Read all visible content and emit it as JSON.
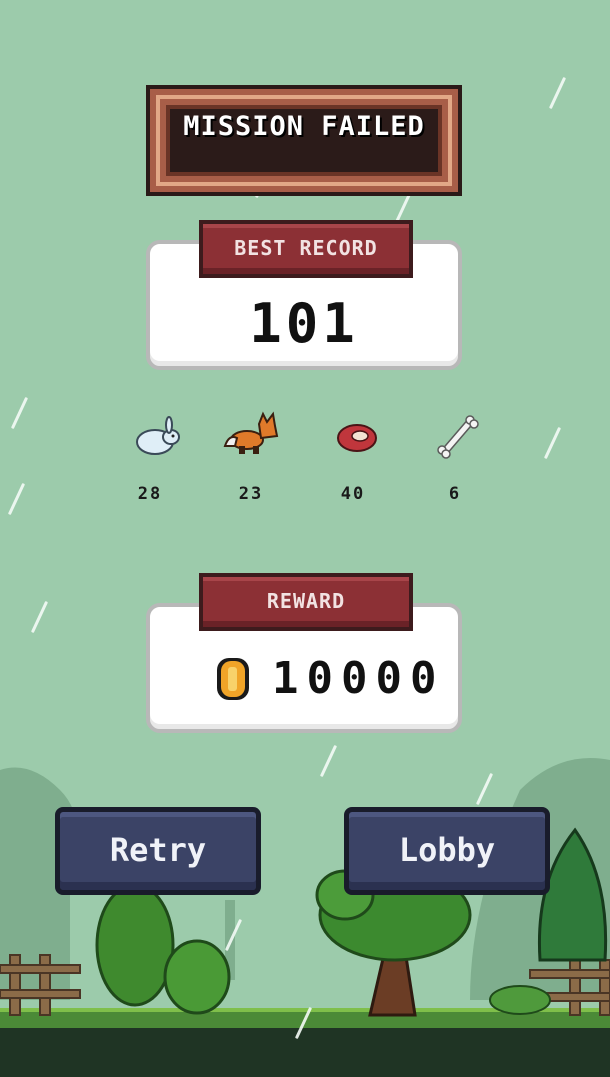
{
  "title": "MISSION FAILED",
  "best_record": {
    "label": "BEST RECORD",
    "value": "101"
  },
  "stats": [
    {
      "icon": "rabbit-icon",
      "value": "28"
    },
    {
      "icon": "fox-icon",
      "value": "23"
    },
    {
      "icon": "meat-icon",
      "value": "40"
    },
    {
      "icon": "bone-icon",
      "value": "6"
    }
  ],
  "reward": {
    "label": "REWARD",
    "icon": "coin-icon",
    "value": "10000"
  },
  "buttons": {
    "retry": "Retry",
    "lobby": "Lobby"
  },
  "colors": {
    "background": "#9ccbab",
    "tag_red": "#8c3035",
    "button_navy": "#3b4366",
    "title_frame": "#a85e48",
    "coin_gold": "#f0a428"
  }
}
